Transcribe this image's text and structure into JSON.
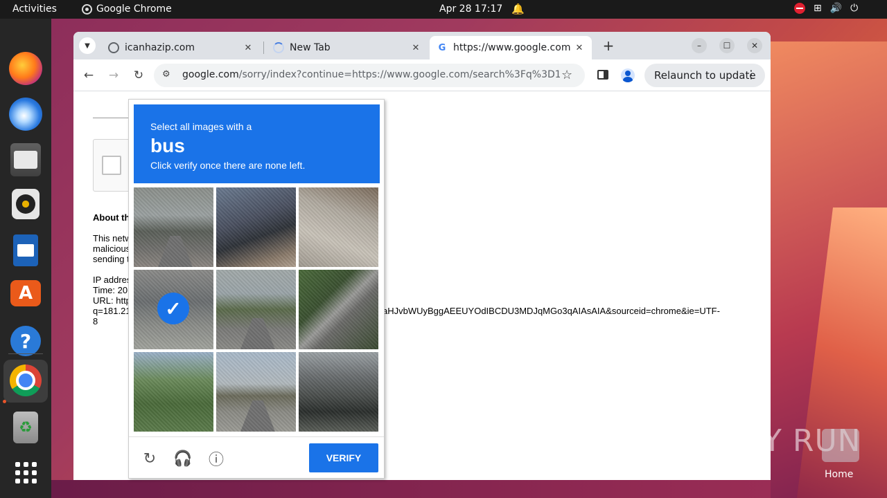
{
  "topbar": {
    "activities": "Activities",
    "app_name": "Google Chrome",
    "datetime": "Apr 28  17:17",
    "icons": [
      "bell-icon",
      "do-not-disturb-icon",
      "network-icon",
      "volume-icon",
      "power-icon"
    ]
  },
  "dock": {
    "items": [
      "firefox",
      "thunderbird",
      "files",
      "rhythmbox",
      "libreoffice-writer",
      "app-center",
      "help",
      "google-chrome",
      "trash",
      "show-applications"
    ]
  },
  "browser": {
    "tabs": [
      {
        "title": "icanhazip.com",
        "favicon": "globe-icon"
      },
      {
        "title": "New Tab",
        "favicon": "loading-spinner-icon"
      },
      {
        "title": "https://www.google.com",
        "favicon": "google-icon"
      }
    ],
    "address": {
      "host": "google.com",
      "path": "/sorry/index?continue=https://www.google.com/search%3Fq%3D181.2..."
    },
    "relaunch_label": "Relaunch to update"
  },
  "page": {
    "about_heading": "About th",
    "para_lines": [
      "This netw",
      "malicious",
      "sending t"
    ],
    "ip_lines": [
      "IP addres",
      "Time: 20",
      "URL: http"
    ],
    "url_line_left": "q=181.21",
    "url_line_right": "aHJvbWUyBggAEEUYOdIBCDU3MDJqMGo3qAIAsAIA&sourceid=chrome&ie=UTF-",
    "url_line_end": "8"
  },
  "captcha": {
    "instruction_line1": "Select all images with a",
    "target_object": "bus",
    "instruction_line3": "Click verify once there are none left.",
    "selected_tiles": [
      4
    ],
    "verify_label": "VERIFY"
  },
  "watermark": "ANY RUN",
  "desktop": {
    "home_label": "Home"
  },
  "colors": {
    "captcha_blue": "#1a73e8",
    "topbar": "#1a1a1a",
    "dock": "#262626"
  }
}
